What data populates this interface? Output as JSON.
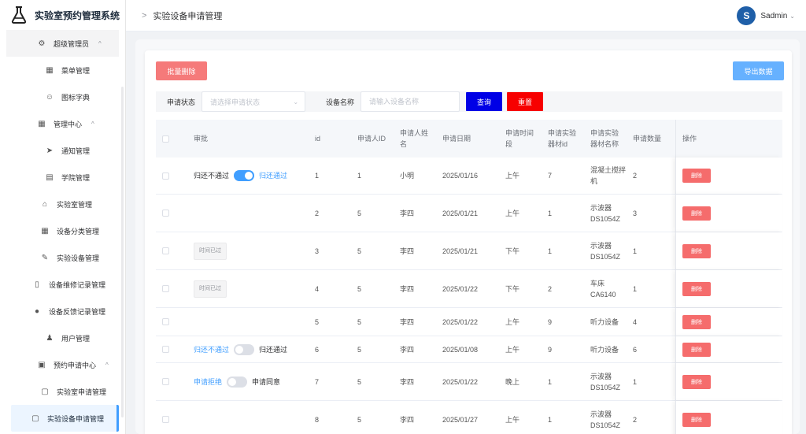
{
  "app": {
    "title": "实验室预约管理系统"
  },
  "sidebar": {
    "items": [
      {
        "label": "超级管理员",
        "icon": "gear-icon",
        "kind": "group",
        "chevron": "^"
      },
      {
        "label": "菜单管理",
        "icon": "grid-icon",
        "kind": "sub"
      },
      {
        "label": "图标字典",
        "icon": "smile-icon",
        "kind": "sub"
      },
      {
        "label": "管理中心",
        "icon": "grid-icon",
        "kind": "group",
        "chevron": "^"
      },
      {
        "label": "通知管理",
        "icon": "send-icon",
        "kind": "sub"
      },
      {
        "label": "学院管理",
        "icon": "building-icon",
        "kind": "sub"
      },
      {
        "label": "实验室管理",
        "icon": "home-icon",
        "kind": "sub2"
      },
      {
        "label": "设备分类管理",
        "icon": "grid-icon",
        "kind": "sub2"
      },
      {
        "label": "实验设备管理",
        "icon": "edit-icon",
        "kind": "sub2"
      },
      {
        "label": "设备维修记录管理",
        "icon": "document-icon",
        "kind": "sub3"
      },
      {
        "label": "设备反馈记录管理",
        "icon": "alert-icon",
        "kind": "sub3"
      },
      {
        "label": "用户管理",
        "icon": "user-icon",
        "kind": "sub"
      },
      {
        "label": "预约申请中心",
        "icon": "tickets-icon",
        "kind": "group",
        "chevron": "^"
      },
      {
        "label": "实验室申请管理",
        "icon": "clipboard-icon",
        "kind": "sub2"
      },
      {
        "label": "实验设备申请管理",
        "icon": "clipboard-icon",
        "kind": "active"
      }
    ]
  },
  "header": {
    "breadcrumb_sep": ">",
    "breadcrumb": "实验设备申请管理"
  },
  "user": {
    "avatar_letter": "S",
    "name": "Sadmin",
    "chevron": "⌄"
  },
  "toolbar": {
    "batch_delete": "批量删除",
    "export": "导出数据"
  },
  "filter": {
    "status_label": "申请状态",
    "status_placeholder": "请选择申请状态",
    "device_label": "设备名称",
    "device_placeholder": "请输入设备名称",
    "query": "查询",
    "reset": "重置"
  },
  "table": {
    "columns": [
      "审批",
      "id",
      "申请人ID",
      "申请人姓名",
      "申请日期",
      "申请时间段",
      "申请实验器材id",
      "申请实验器材名称",
      "申请数量",
      "操作"
    ],
    "delete_label": "删除",
    "rows": [
      {
        "approval": {
          "type": "switch",
          "left": "归还不通过",
          "right": "归还通过",
          "on": true
        },
        "id": "1",
        "uid": "1",
        "uname": "小明",
        "date": "2025/01/16",
        "period": "上午",
        "eid": "7",
        "ename": "混凝土搅拌机",
        "qty": "2"
      },
      {
        "approval": {
          "type": "none"
        },
        "id": "2",
        "uid": "5",
        "uname": "李四",
        "date": "2025/01/21",
        "period": "上午",
        "eid": "1",
        "ename": "示波器 DS1054Z",
        "qty": "3"
      },
      {
        "approval": {
          "type": "tag",
          "text": "时间已过"
        },
        "id": "3",
        "uid": "5",
        "uname": "李四",
        "date": "2025/01/21",
        "period": "下午",
        "eid": "1",
        "ename": "示波器 DS1054Z",
        "qty": "1"
      },
      {
        "approval": {
          "type": "tag",
          "text": "时间已过"
        },
        "id": "4",
        "uid": "5",
        "uname": "李四",
        "date": "2025/01/22",
        "period": "下午",
        "eid": "2",
        "ename": "车床 CA6140",
        "qty": "1"
      },
      {
        "approval": {
          "type": "none"
        },
        "id": "5",
        "uid": "5",
        "uname": "李四",
        "date": "2025/01/22",
        "period": "上午",
        "eid": "9",
        "ename": "听力设备",
        "qty": "4"
      },
      {
        "approval": {
          "type": "switch",
          "left": "归还不通过",
          "right": "归还通过",
          "on": false
        },
        "id": "6",
        "uid": "5",
        "uname": "李四",
        "date": "2025/01/08",
        "period": "上午",
        "eid": "9",
        "ename": "听力设备",
        "qty": "6"
      },
      {
        "approval": {
          "type": "switch",
          "left": "申请拒绝",
          "right": "申请同意",
          "on": false
        },
        "id": "7",
        "uid": "5",
        "uname": "李四",
        "date": "2025/01/22",
        "period": "晚上",
        "eid": "1",
        "ename": "示波器 DS1054Z",
        "qty": "1"
      },
      {
        "approval": {
          "type": "none"
        },
        "id": "8",
        "uid": "5",
        "uname": "李四",
        "date": "2025/01/27",
        "period": "上午",
        "eid": "1",
        "ename": "示波器 DS1054Z",
        "qty": "2"
      }
    ]
  }
}
